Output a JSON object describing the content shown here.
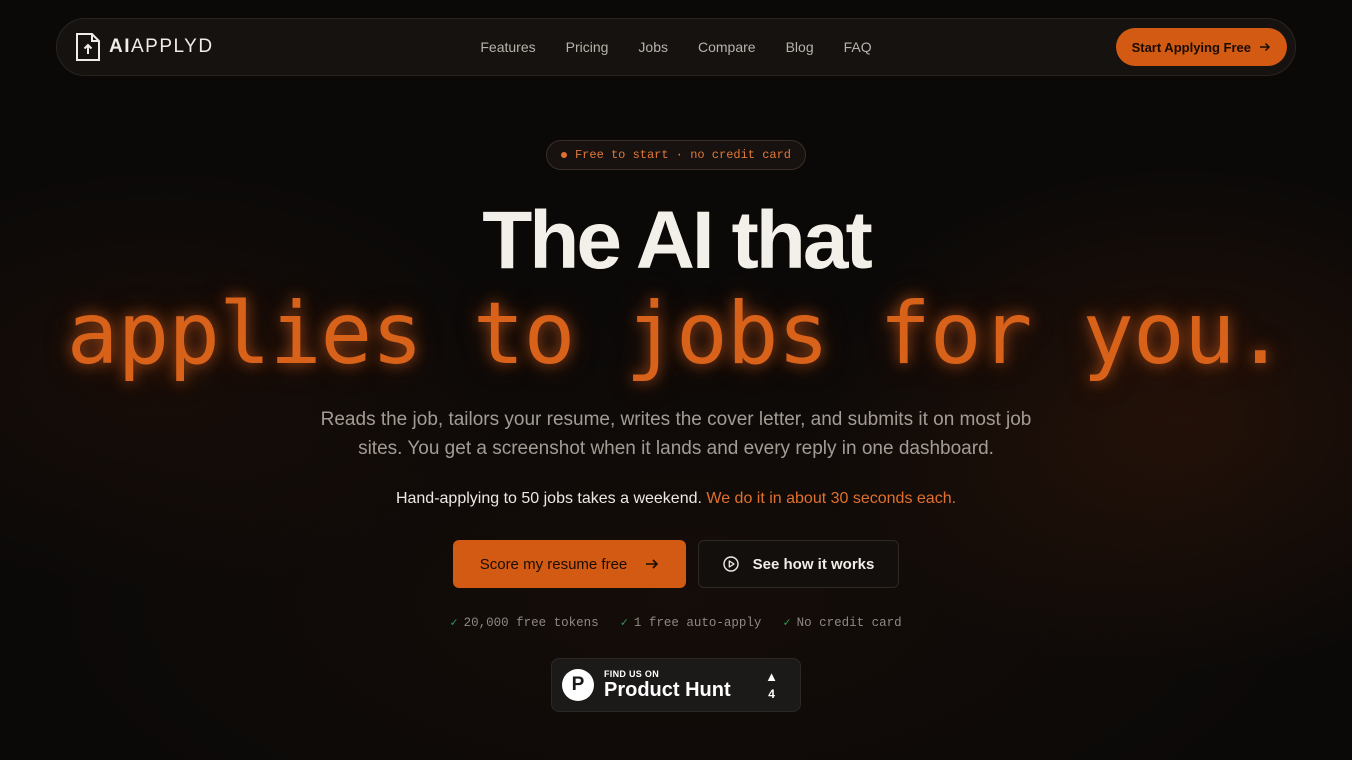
{
  "brand": {
    "name_bold": "AI",
    "name_regular": "APPLYD",
    "logo_icon": "document-upload-icon"
  },
  "nav": {
    "links": [
      "Features",
      "Pricing",
      "Jobs",
      "Compare",
      "Blog",
      "FAQ"
    ],
    "cta_label": "Start Applying Free"
  },
  "hero": {
    "badge": "Free to start · no credit card",
    "title_line1": "The AI that",
    "title_line2": "applies to jobs for you.",
    "subtitle": "Reads the job, tailors your resume, writes the cover letter, and submits it on most job sites. You get a screenshot when it lands and every reply in one dashboard.",
    "claim_plain": "Hand-applying to 50 jobs takes a weekend.",
    "claim_accent": "We do it in about 30 seconds each.",
    "primary_button": "Score my resume free",
    "secondary_button": "See how it works",
    "checks": [
      "20,000 free tokens",
      "1 free auto-apply",
      "No credit card"
    ]
  },
  "product_hunt": {
    "small_label": "FIND US ON",
    "name": "Product Hunt",
    "logo_letter": "P",
    "upvotes": "4"
  },
  "colors": {
    "accent": "#d25a12",
    "accent_text": "#e0702c",
    "background": "#0b0908",
    "check_green": "#2f9d5a"
  }
}
